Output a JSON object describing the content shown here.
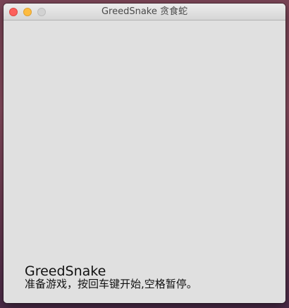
{
  "window": {
    "title": "GreedSnake 贪食蛇"
  },
  "controls": {
    "close_icon": "close-icon",
    "minimize_icon": "minimize-icon",
    "zoom_icon": "zoom-icon"
  },
  "colors": {
    "close": "#fc605c",
    "minimize": "#fdbc40",
    "zoom_disabled": "#d2d2d2",
    "canvas_bg": "#e0e0e0",
    "text": "#111111"
  },
  "game": {
    "title": "GreedSnake",
    "hint": "准备游戏，按回车键开始,空格暂停。"
  }
}
